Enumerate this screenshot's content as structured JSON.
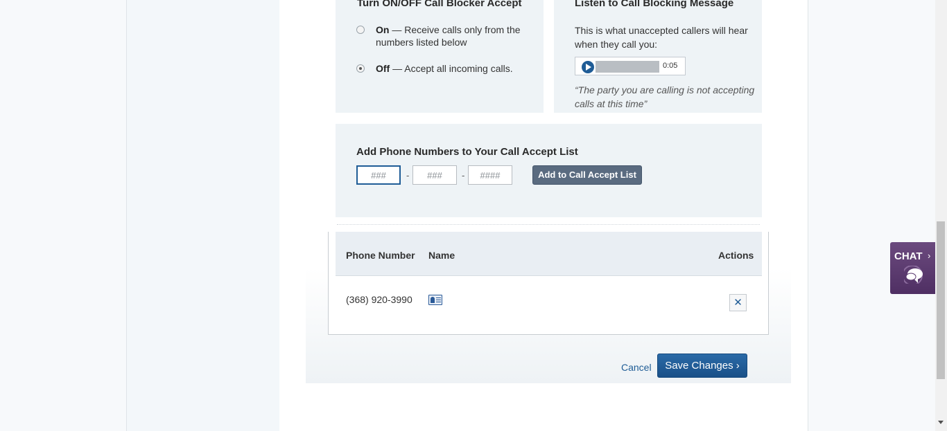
{
  "onoff": {
    "title": "Turn ON/OFF Call Blocker Accept",
    "on_label": "On",
    "on_desc": " — Receive calls only from the numbers listed below",
    "off_label": "Off",
    "off_desc": " — Accept all incoming calls.",
    "selected": "off"
  },
  "listen": {
    "title": "Listen to Call Blocking Message",
    "description": "This is what unaccepted callers will hear when they call you:",
    "player_time": "0:05",
    "quote": "“The party you are calling is not accepting calls at this time”"
  },
  "add": {
    "title": "Add Phone Numbers to Your Call Accept List",
    "area_placeholder": "###",
    "prefix_placeholder": "###",
    "line_placeholder": "####",
    "separator": "-",
    "button_label": "Add to Call Accept List"
  },
  "list": {
    "headers": {
      "phone": "Phone Number",
      "name": "Name",
      "actions": "Actions"
    },
    "rows": [
      {
        "phone": "(368) 920-3990",
        "name": ""
      }
    ],
    "delete_glyph": "✕"
  },
  "footer": {
    "cancel_label": "Cancel",
    "save_label": "Save Changes ›"
  },
  "chat": {
    "label": "CHAT",
    "arrow": "›"
  },
  "colors": {
    "accent": "#1f5c96",
    "chat": "#5b3a70",
    "button_gray": "#5a6b80"
  }
}
